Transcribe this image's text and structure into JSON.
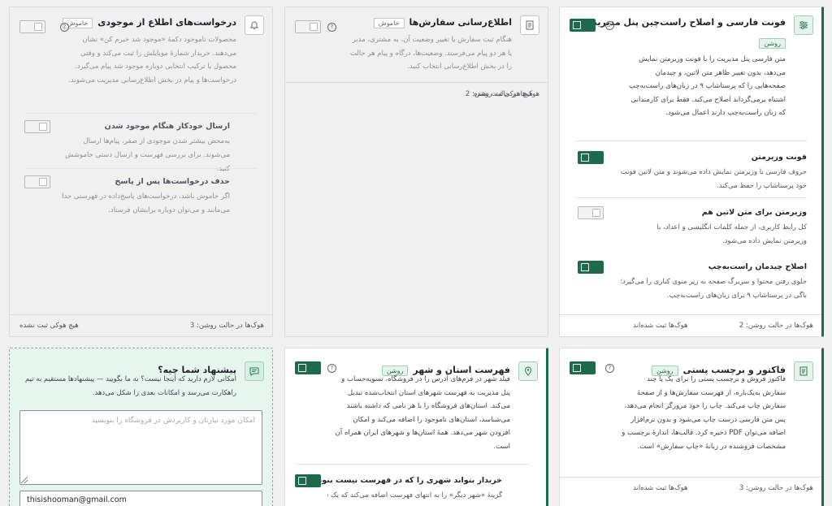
{
  "font_card": {
    "icon": "sliders-icon",
    "title": "فونت فارسی و اصلاح راست‌چین پنل مدیریت",
    "badge": "روشن",
    "desc": "متن فارسی پنل مدیریت را با فونت وزیرمتن نمایش می‌دهد، بدون تغییر ظاهر متن لاتین، و چیدمان صفحه‌هایی را که پرستاشاپ ۹ در زبان‌های راست‌به‌چپ اشتباه برمی‌گرداند اصلاح می‌کند. فقط برای کارمندانی که زبان راست‌به‌چپ دارند اعمال می‌شود.",
    "settings": [
      {
        "title": "فونت وزیرمتن",
        "desc": "حروف فارسی با وزیرمتن نمایش داده می‌شوند و متن لاتین فونت خود پرستاشاپ را حفظ می‌کند.",
        "on": true
      },
      {
        "title": "وزیرمتن برای متن لاتین هم",
        "desc": "کل رابط کاربری، از جمله کلمات انگلیسی و اعداد، با وزیرمتن نمایش داده می‌شود.",
        "on": false
      },
      {
        "title": "اصلاح چیدمان راست‌به‌چپ",
        "desc": "جلوی رفتن محتوا و سربرگ صفحه به زیر منوی کناری را می‌گیرد؛ باگی در پرستاشاپ ۹ برای زبان‌های راست‌به‌چپ.",
        "on": true
      }
    ],
    "foot_active": "هوک‌ها در حالت روشن: 2",
    "foot_status": "هوک‌ها ثبت شده‌اند"
  },
  "order_card": {
    "icon": "document-icon",
    "title": "اطلاع‌رسانی سفارش‌ها",
    "badge": "خاموش",
    "desc": "هنگام ثبت سفارش یا تغییر وضعیت آن، به مشتری، مدیر یا هر دو پیام می‌فرستد. وضعیت‌ها، درگاه و پیام هر حالت را در بخش اطلاع‌رسانی انتخاب کنید.",
    "foot_active": "هوک‌ها در حالت روشن: 2",
    "foot_status": "هیچ هوکی ثبت نشده"
  },
  "stock_card": {
    "icon": "bell-icon",
    "title": "درخواست‌های اطلاع از موجودی",
    "badge": "خاموش",
    "desc": "محصولات ناموجود دکمهٔ «موجود شد خبرم کن» نشان می‌دهند. خریدار شمارهٔ موبایلش را ثبت می‌کند و وقتی محصول یا ترکیب انتخابی دوباره موجود شد پیام می‌گیرد. درخواست‌ها و پیام در بخش اطلاع‌رسانی مدیریت می‌شوند.",
    "settings": [
      {
        "title": "ارسال خودکار هنگام موجود شدن",
        "desc": "به‌محض بیشتر شدن موجودی از صفر، پیام‌ها ارسال می‌شوند. برای بررسی فهرست و ارسال دستی خاموشش کنید."
      },
      {
        "title": "حذف درخواست‌ها پس از پاسخ",
        "desc": "اگر خاموش باشد، درخواست‌های پاسخ‌داده در فهرستی جدا می‌مانند و می‌توان دوباره برایشان فرستاد."
      }
    ],
    "foot_active": "هوک‌ها در حالت روشن: 3",
    "foot_status": "هیچ هوکی ثبت نشده"
  },
  "invoice_card": {
    "icon": "invoice-icon",
    "title": "فاکتور و برچسب پستی",
    "badge": "روشن",
    "desc": "فاکتور فروش و برچسب پستی را برای یک یا چند سفارش به‌یک‌باره، از فهرست سفارش‌ها و از صفحهٔ سفارش چاپ می‌کند. چاپ را خود مرورگر انجام می‌دهد، پس متن فارسی درست چاپ می‌شود و بدون نرم‌افزار اضافه می‌توان PDF ذخیره کرد. قالب‌ها، اندازهٔ برچسب و مشخصات فروشنده در زبانهٔ «چاپ سفارش» است.",
    "foot_active": "هوک‌ها در حالت روشن: 3",
    "foot_status": "هوک‌ها ثبت شده‌اند"
  },
  "city_card": {
    "icon": "map-pin-icon",
    "title": "فهرست استان و شهر",
    "badge": "روشن",
    "desc": "فیلد شهر در فرم‌های آدرس را در فروشگاه، تسویه‌حساب و پنل مدیریت به فهرست شهرهای استان انتخاب‌شده تبدیل می‌کند. استان‌های فروشگاه را با هر نامی که داشته باشند می‌شناسد، استان‌های ناموجود را اضافه می‌کند و امکان افزودن شهر می‌دهد. همهٔ استان‌ها و شهرهای ایران همراه آن است.",
    "setting_title": "خریدار بتواند شهری را که در فهرست نیست بنویسد",
    "setting_desc": "گزینهٔ «شهر دیگر» را به انتهای فهرست اضافه می‌کند که یک فیلد متنی"
  },
  "suggest_card": {
    "icon": "chat-icon",
    "title": "پیشنهاد شما چیه؟",
    "desc": "امکانی لازم دارید که اینجا نیست؟ به ما بگویید — پیشنهادها مستقیم به تیم راهکارت می‌رسد و امکانات بعدی را شکل می‌دهد.",
    "placeholder": "امکان مورد نیازتان و کاربردش در فروشگاه را بنویسید",
    "email": "thisishooman@gmail.com"
  }
}
